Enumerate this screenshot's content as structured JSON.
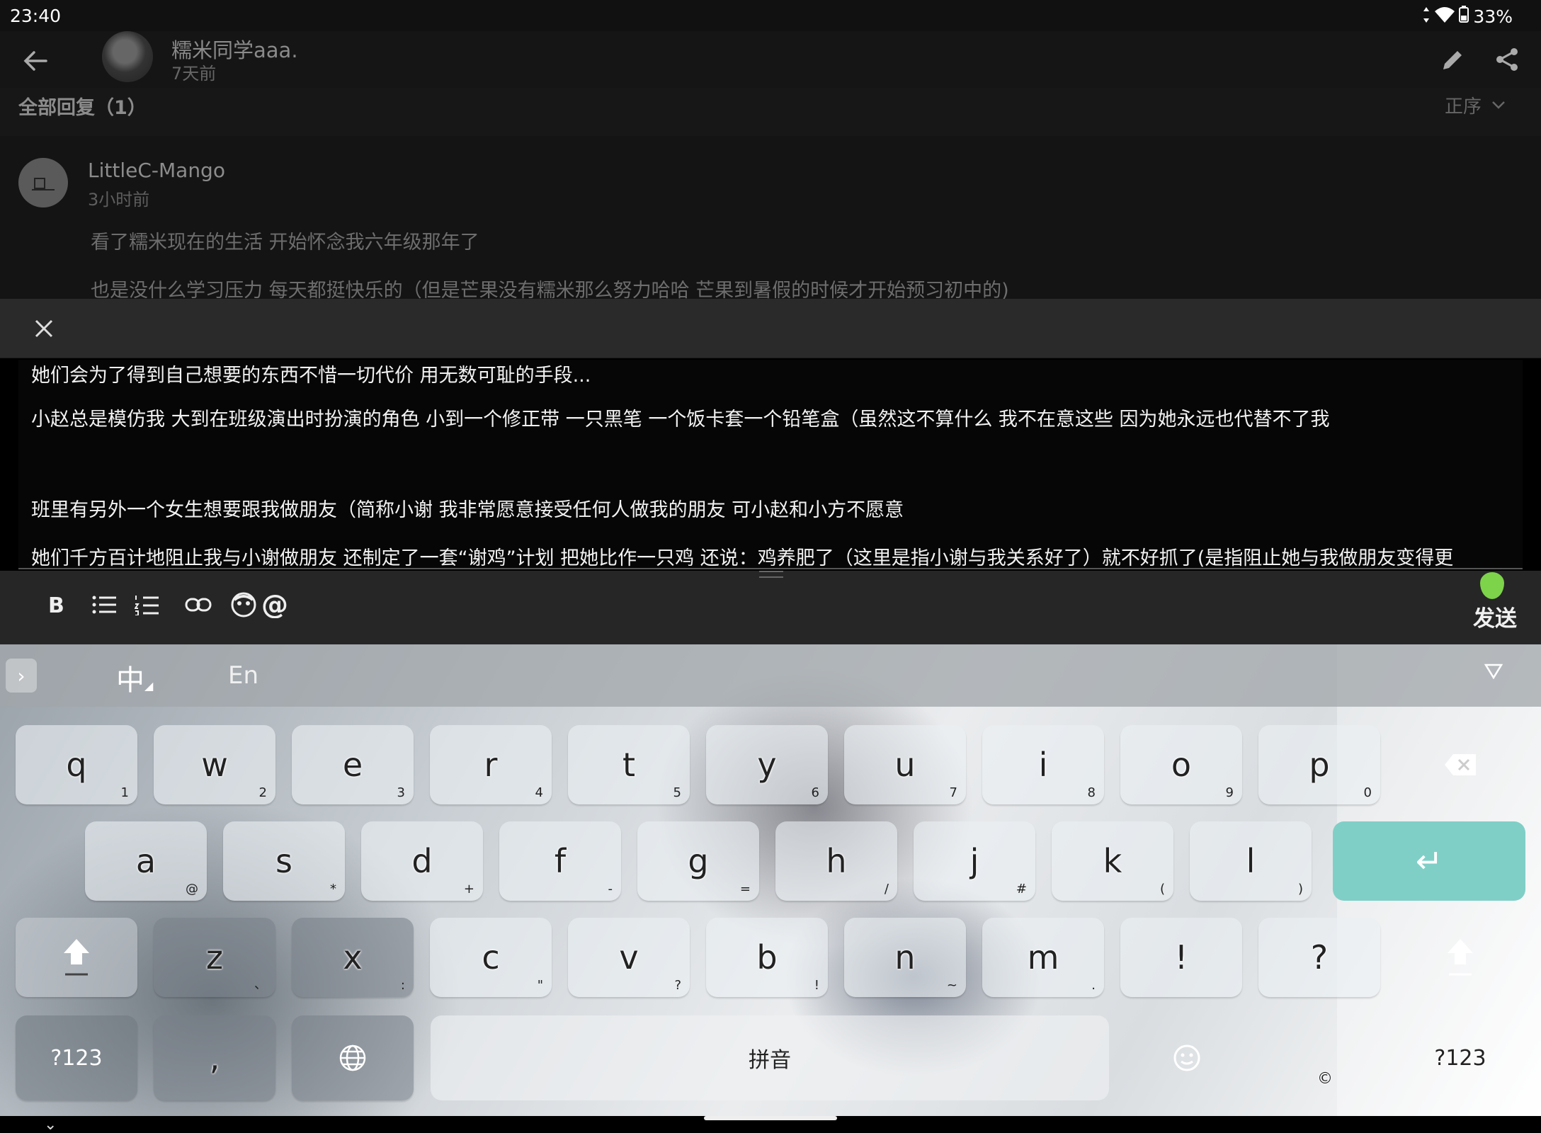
{
  "status": {
    "time": "23:40",
    "battery": "33%"
  },
  "post": {
    "author": "糯米同学aaa.",
    "time": "7天前"
  },
  "comments": {
    "header": "全部回复（1）",
    "sort": "正序",
    "reply": {
      "name": "LittleC-Mango",
      "time": "3小时前",
      "p1": "看了糯米现在的生活 开始怀念我六年级那年了",
      "p2": "也是没什么学习压力 每天都挺快乐的（但是芒果没有糯米那么努力哈哈 芒果到暑假的时候才开始预习初中的)"
    }
  },
  "editor": {
    "lines": [
      "她们会为了得到自己想要的东西不惜一切代价 用无数可耻的手段...",
      "小赵总是模仿我 大到在班级演出时扮演的角色  小到一个修正带 一只黑笔 一个饭卡套一个铅笔盒（虽然这不算什么 我不在意这些 因为她永远也代替不了我",
      "班里有另外一个女生想要跟我做朋友（简称小谢 我非常愿意接受任何人做我的朋友 可小赵和小方不愿意",
      "她们千方百计地阻止我与小谢做朋友 还制定了一套“谢鸡”计划 把她比作一只鸡 还说：鸡养肥了（这里是指小谢与我关系好了）就不好抓了(是指阻止她与我做朋友变得更"
    ],
    "send_label": "发送"
  },
  "keyboard": {
    "mode_zh": "中",
    "mode_en": "En",
    "row1": [
      {
        "k": "q",
        "s": "1"
      },
      {
        "k": "w",
        "s": "2"
      },
      {
        "k": "e",
        "s": "3"
      },
      {
        "k": "r",
        "s": "4"
      },
      {
        "k": "t",
        "s": "5"
      },
      {
        "k": "y",
        "s": "6"
      },
      {
        "k": "u",
        "s": "7"
      },
      {
        "k": "i",
        "s": "8"
      },
      {
        "k": "o",
        "s": "9"
      },
      {
        "k": "p",
        "s": "0"
      }
    ],
    "row2": [
      {
        "k": "a",
        "s": "@"
      },
      {
        "k": "s",
        "s": "*"
      },
      {
        "k": "d",
        "s": "+"
      },
      {
        "k": "f",
        "s": "-"
      },
      {
        "k": "g",
        "s": "="
      },
      {
        "k": "h",
        "s": "/"
      },
      {
        "k": "j",
        "s": "#"
      },
      {
        "k": "k",
        "s": "("
      },
      {
        "k": "l",
        "s": ")"
      }
    ],
    "row3": [
      {
        "k": "z",
        "s": "、"
      },
      {
        "k": "x",
        "s": ":"
      },
      {
        "k": "c",
        "s": "\""
      },
      {
        "k": "v",
        "s": "?"
      },
      {
        "k": "b",
        "s": "!"
      },
      {
        "k": "n",
        "s": "~"
      },
      {
        "k": "m",
        "s": "."
      },
      {
        "k": "!",
        "s": ""
      },
      {
        "k": "?",
        "s": ""
      }
    ],
    "sym_left": "?123",
    "comma": ",",
    "space": "拼音",
    "copyright": "©",
    "sym_right": "?123",
    "enter_glyph": "↵"
  }
}
